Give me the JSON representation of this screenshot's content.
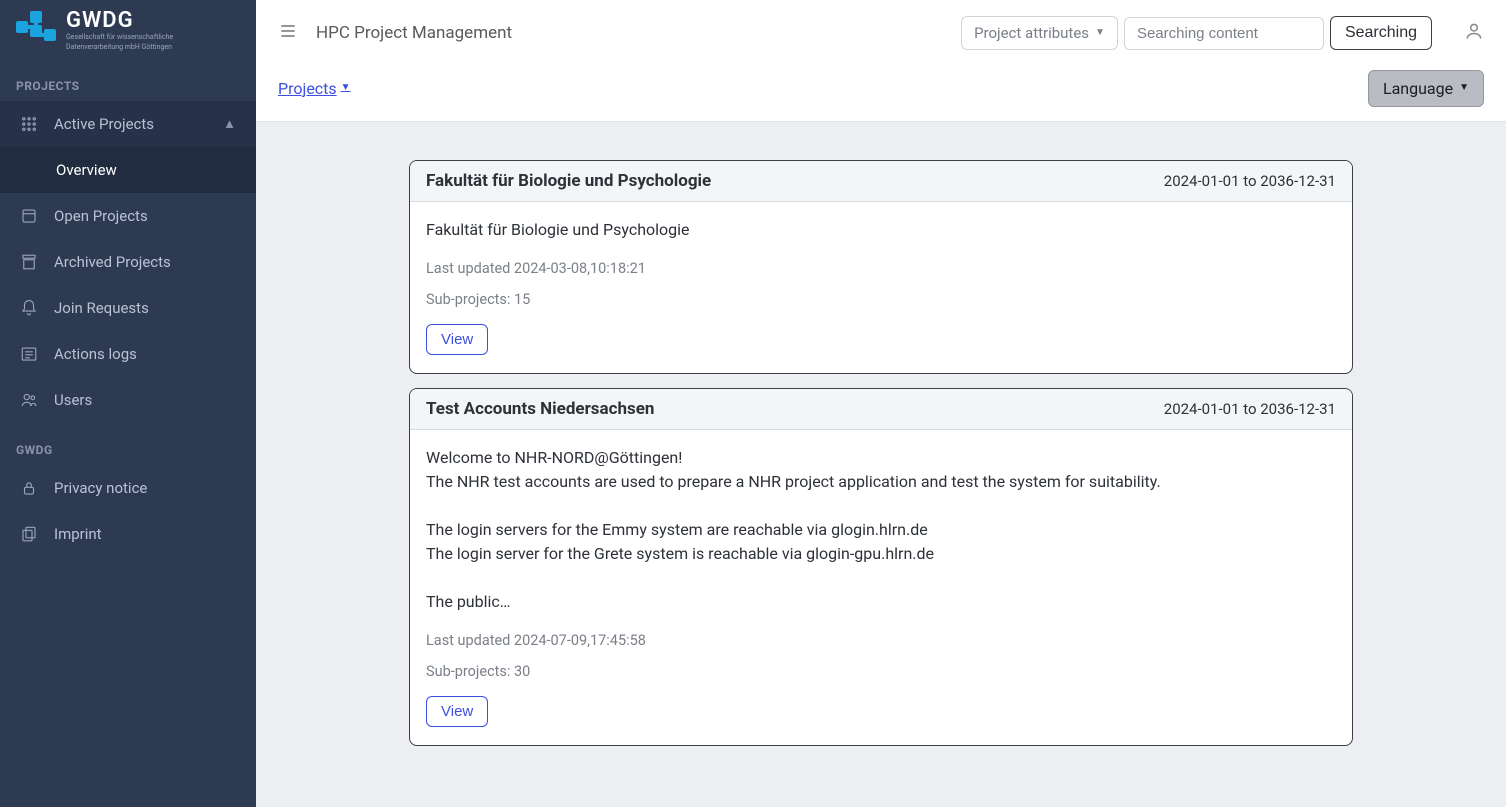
{
  "brand": {
    "name": "GWDG",
    "subtitle1": "Gesellschaft für wissenschaftliche",
    "subtitle2": "Datenverarbeitung mbH Göttingen"
  },
  "sidebar": {
    "section_projects": "PROJECTS",
    "section_gwdg": "GWDG",
    "active_projects": "Active Projects",
    "overview": "Overview",
    "open_projects": "Open Projects",
    "archived_projects": "Archived Projects",
    "join_requests": "Join Requests",
    "actions_logs": "Actions logs",
    "users": "Users",
    "privacy_notice": "Privacy notice",
    "imprint": "Imprint"
  },
  "header": {
    "page_title": "HPC Project Management",
    "attr_dropdown": "Project attributes",
    "search_placeholder": "Searching content",
    "search_button": "Searching"
  },
  "subheader": {
    "breadcrumb": "Projects",
    "language": "Language"
  },
  "projects": [
    {
      "title": "Fakultät für Biologie und Psychologie",
      "date_range": "2024-01-01 to 2036-12-31",
      "description": "Fakultät für Biologie und Psychologie",
      "last_updated": "Last updated 2024-03-08,10:18:21",
      "subprojects": "Sub-projects: 15",
      "view": "View"
    },
    {
      "title": "Test Accounts Niedersachsen",
      "date_range": "2024-01-01 to 2036-12-31",
      "description": "Welcome to NHR-NORD@Göttingen!\nThe NHR test accounts are used to prepare a NHR project application and test the system for suitability.\n\nThe login servers for the Emmy system are reachable via glogin.hlrn.de\nThe login server for the Grete system is reachable via glogin-gpu.hlrn.de\n\nThe public…",
      "last_updated": "Last updated 2024-07-09,17:45:58",
      "subprojects": "Sub-projects: 30",
      "view": "View"
    }
  ]
}
